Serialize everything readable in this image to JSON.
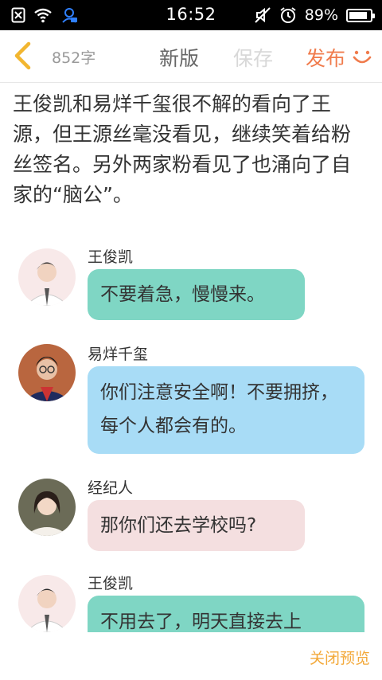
{
  "status_bar": {
    "time": "16:52",
    "battery_pct": "89%",
    "battery_level": 0.89,
    "icons_left": [
      "notification-x-icon",
      "wifi-icon",
      "account-icon"
    ],
    "icons_right": [
      "mute-icon",
      "alarm-icon",
      "battery-icon"
    ]
  },
  "toolbar": {
    "word_count": "852字",
    "new_label": "新版",
    "save_label": "保存",
    "publish_label": "发布",
    "accent_color": "#f07b4c"
  },
  "paragraph": "王俊凯和易烊千玺很不解的看向了王源，但王源丝毫没看见，继续笑着给粉丝签名。另外两家粉看见了也涌向了自家的“脑公”。",
  "messages": [
    {
      "sender": "王俊凯",
      "text": "不要着急，慢慢来。",
      "bubble_color": "#7fd6c4"
    },
    {
      "sender": "易烊千玺",
      "text": "你们注意安全啊！不要拥挤，每个人都会有的。",
      "bubble_color": "#a8dcf6"
    },
    {
      "sender": "经纪人",
      "text": "那你们还去学校吗?",
      "bubble_color": "#f4dfe0"
    },
    {
      "sender": "王俊凯",
      "text": "不用去了，明天直接去上",
      "bubble_color": "#7fd6c4"
    }
  ],
  "bottom": {
    "close_preview_label": "关闭预览",
    "close_color": "#f3a93a"
  }
}
